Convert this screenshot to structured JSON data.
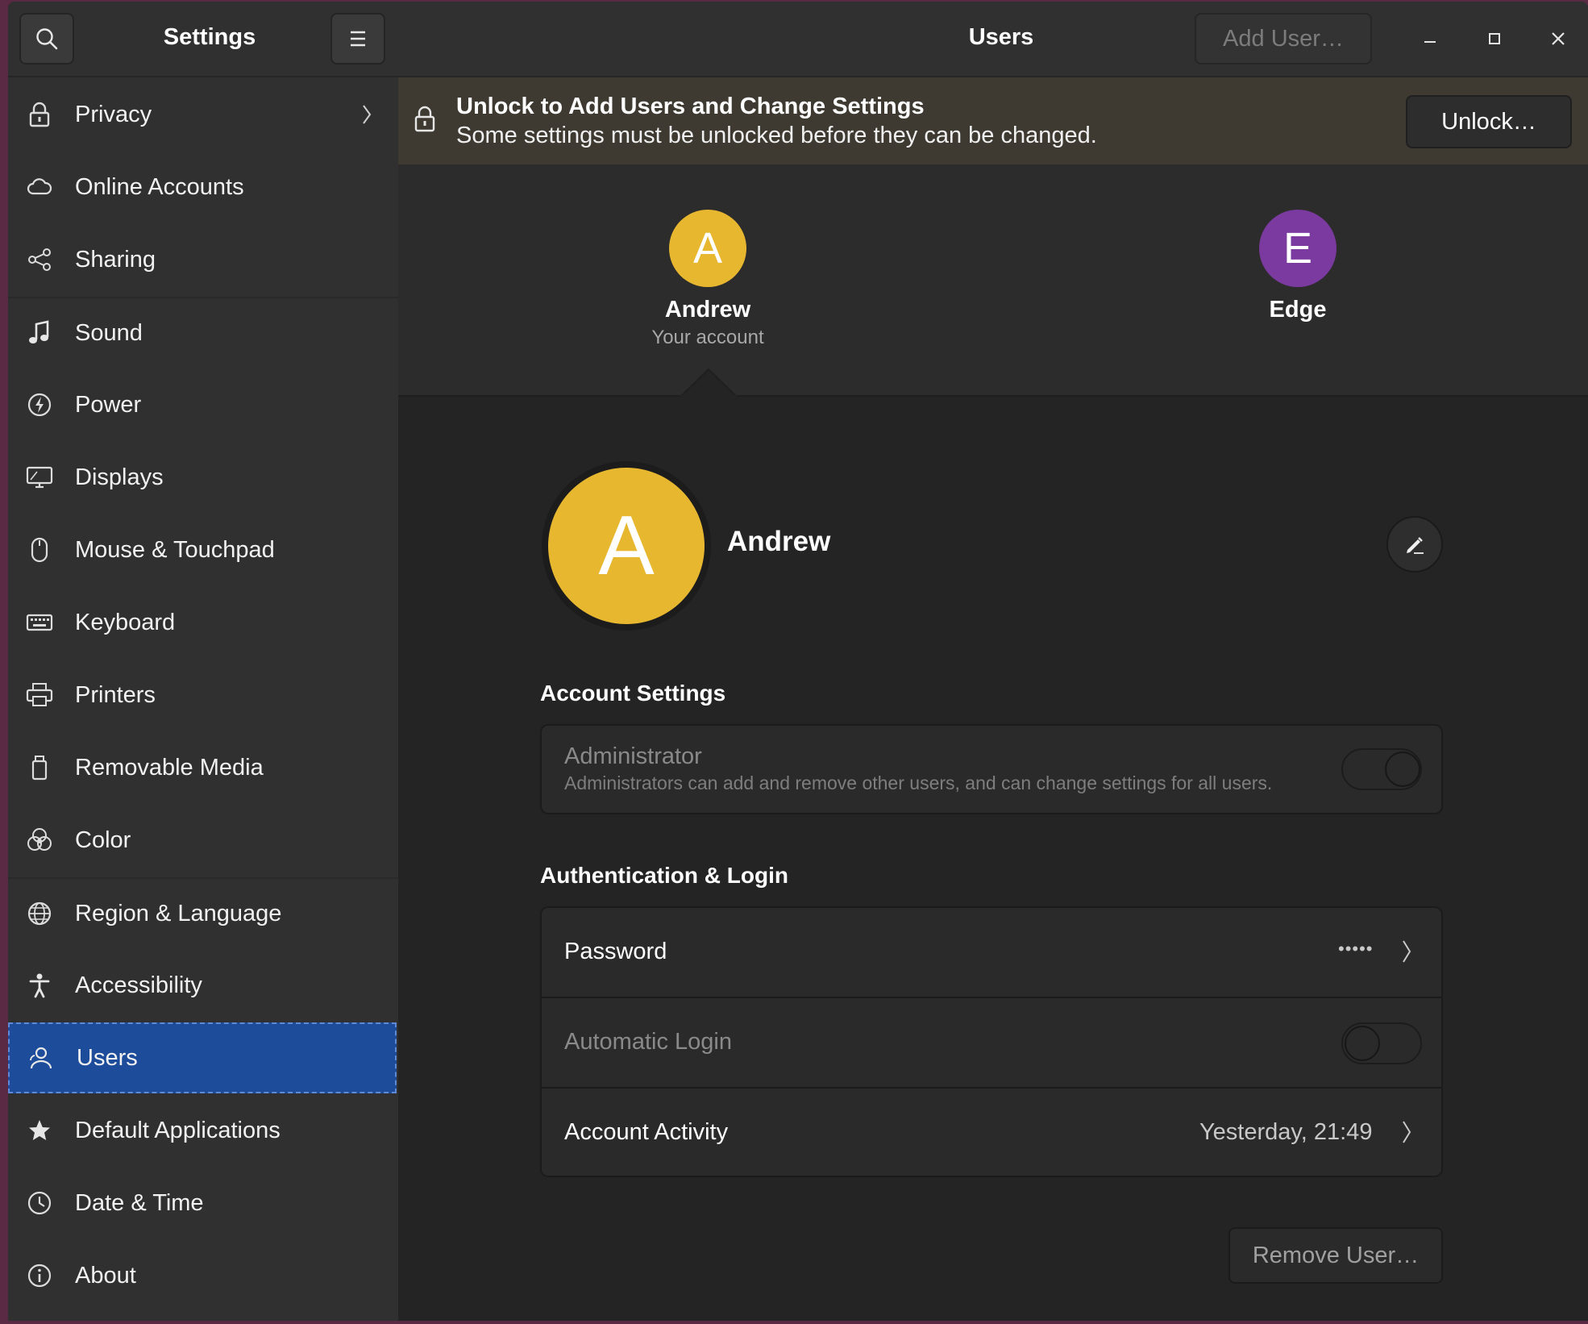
{
  "sidebar": {
    "title": "Settings",
    "items": [
      {
        "label": "Privacy",
        "icon": "lock-icon",
        "has_chevron": true
      },
      {
        "label": "Online Accounts",
        "icon": "cloud-icon"
      },
      {
        "label": "Sharing",
        "icon": "share-icon"
      },
      {
        "label": "Sound",
        "icon": "music-note-icon"
      },
      {
        "label": "Power",
        "icon": "power-icon"
      },
      {
        "label": "Displays",
        "icon": "display-icon"
      },
      {
        "label": "Mouse & Touchpad",
        "icon": "mouse-icon"
      },
      {
        "label": "Keyboard",
        "icon": "keyboard-icon"
      },
      {
        "label": "Printers",
        "icon": "printer-icon"
      },
      {
        "label": "Removable Media",
        "icon": "removable-media-icon"
      },
      {
        "label": "Color",
        "icon": "color-icon"
      },
      {
        "label": "Region & Language",
        "icon": "globe-icon"
      },
      {
        "label": "Accessibility",
        "icon": "accessibility-icon"
      },
      {
        "label": "Users",
        "icon": "users-icon",
        "active": true
      },
      {
        "label": "Default Applications",
        "icon": "star-icon"
      },
      {
        "label": "Date & Time",
        "icon": "clock-icon"
      },
      {
        "label": "About",
        "icon": "info-icon"
      }
    ]
  },
  "header": {
    "title": "Users",
    "add_user_label": "Add User…"
  },
  "infobar": {
    "title": "Unlock to Add Users and Change Settings",
    "subtitle": "Some settings must be unlocked before they can be changed.",
    "unlock_label": "Unlock…"
  },
  "users": [
    {
      "initial": "A",
      "name": "Andrew",
      "subtitle": "Your account",
      "color": "#e8b730"
    },
    {
      "initial": "E",
      "name": "Edge",
      "subtitle": "",
      "color": "#7b3aa0"
    }
  ],
  "detail": {
    "initial": "A",
    "name": "Andrew",
    "account_settings_title": "Account Settings",
    "administrator_label": "Administrator",
    "administrator_desc": "Administrators can add and remove other users, and can change settings for all users.",
    "administrator_enabled": true,
    "auth_title": "Authentication & Login",
    "password_label": "Password",
    "password_value": "•••••",
    "auto_login_label": "Automatic Login",
    "auto_login_enabled": false,
    "activity_label": "Account Activity",
    "activity_value": "Yesterday, 21:49",
    "remove_label": "Remove User…"
  },
  "colors": {
    "accent_selected": "#1d4c9a",
    "avatar_andrew": "#e8b730",
    "avatar_edge": "#7b3aa0",
    "infobar": "#3e3a32"
  }
}
